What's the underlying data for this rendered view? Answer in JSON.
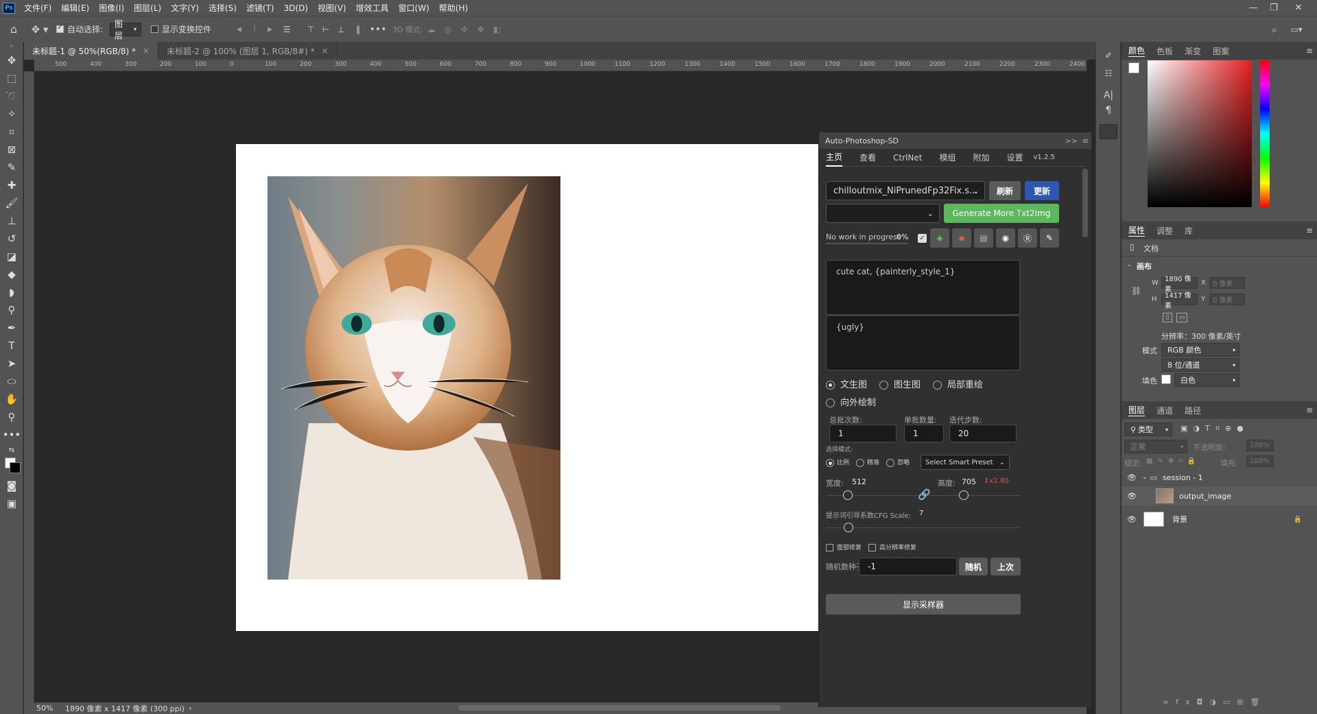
{
  "app": {
    "logo": "Ps"
  },
  "menu": [
    "文件(F)",
    "编辑(E)",
    "图像(I)",
    "图层(L)",
    "文字(Y)",
    "选择(S)",
    "滤镜(T)",
    "3D(D)",
    "视图(V)",
    "增效工具",
    "窗口(W)",
    "帮助(H)"
  ],
  "window_controls": {
    "minimize": "—",
    "restore": "❐",
    "close": "✕"
  },
  "options": {
    "auto_select_label": "自动选择:",
    "auto_select_value": "图层",
    "show_transform_label": "显示变换控件",
    "mode_3d_label": "3D 模式:"
  },
  "doc_tabs": [
    {
      "label": "未标题-1 @ 50%(RGB/8) *",
      "close": "×"
    },
    {
      "label": "未标题-2 @ 100% (图层 1, RGB/8#) *",
      "close": "×"
    }
  ],
  "ruler_marks": [
    "500",
    "400",
    "300",
    "200",
    "100",
    "0",
    "100",
    "200",
    "300",
    "400",
    "500",
    "600",
    "700",
    "800",
    "900",
    "1000",
    "1100",
    "1200",
    "1300",
    "1400",
    "1500",
    "1600",
    "1700",
    "1800",
    "1900",
    "2000",
    "2100",
    "2200",
    "2300",
    "2400"
  ],
  "status": {
    "zoom": "50%",
    "doc_info": "1890 像素 x 1417 像素 (300 ppi)"
  },
  "plugin": {
    "title": "Auto-Photoshop-SD",
    "collapse": ">>",
    "tabs": [
      "主页",
      "查看",
      "CtrlNet",
      "模组",
      "附加",
      "设置"
    ],
    "version": "v1.2.5",
    "model": "chilloutmix_NiPrunedFp32Fix.s...",
    "refresh_label": "刷新",
    "update_label": "更新",
    "generate_label": "Generate More Txt2Img",
    "progress_text": "No work in progress",
    "progress_pct": "0%",
    "prompt": "cute cat, {painterly_style_1}",
    "negative_prompt": "{ugly}",
    "modes": [
      "文生图",
      "图生图",
      "局部重绘",
      "向外绘制"
    ],
    "batch_count_label": "总批次数:",
    "batch_count": "1",
    "batch_size_label": "单批数量:",
    "batch_size": "1",
    "steps_label": "迭代步数:",
    "steps": "20",
    "select_mode_label": "选择模式:",
    "select_modes": [
      "比例",
      "精准",
      "忽略"
    ],
    "smart_preset": "Select Smart Preset",
    "width_label": "宽度:",
    "width": "512",
    "height_label": "高度:",
    "height": "705",
    "ratio": "↕x2.80",
    "cfg_label": "提示词引导系数CFG Scale:",
    "cfg": "7",
    "face_restore_label": "面部修复",
    "hires_fix_label": "高分辨率修复",
    "seed_label": "随机数种子",
    "seed": "-1",
    "random_label": "随机",
    "last_label": "上次",
    "show_sampler_label": "显示采样器",
    "accent_blue": "#2e56b3",
    "accent_green": "#5cb85c"
  },
  "color_panel": {
    "tabs": [
      "颜色",
      "色板",
      "渐变",
      "图案"
    ]
  },
  "properties": {
    "tabs": [
      "属性",
      "调整",
      "库"
    ],
    "doc_label": "文档",
    "canvas_label": "画布",
    "w_label": "W",
    "w_value": "1890 像素",
    "h_label": "H",
    "h_value": "1417 像素",
    "x_label": "X",
    "x_placeholder": "0 像素",
    "y_label": "Y",
    "y_placeholder": "0 像素",
    "resolution": "分辨率：300 像素/英寸",
    "mode_label": "模式",
    "mode_value": "RGB 颜色",
    "depth_value": "8 位/通道",
    "fill_label": "填色",
    "fill_value": "白色"
  },
  "layers_panel": {
    "tabs": [
      "图层",
      "通道",
      "路径"
    ],
    "filter": "类型",
    "blend": "正常",
    "opacity_label": "不透明度:",
    "opacity": "100%",
    "lock_label": "锁定:",
    "fill_label": "填充:",
    "fill": "100%",
    "layers": [
      {
        "name": "session - 1"
      },
      {
        "name": "output_image"
      },
      {
        "name": "背景"
      }
    ]
  }
}
